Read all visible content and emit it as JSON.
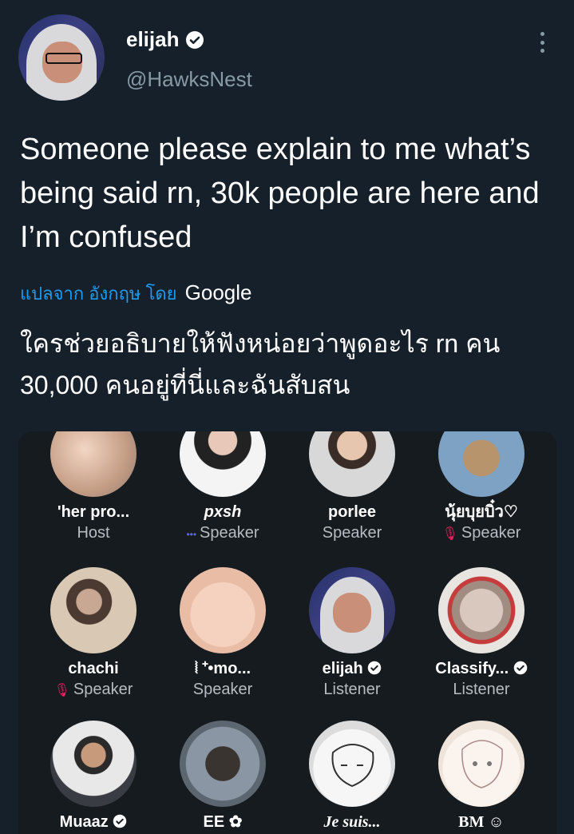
{
  "author": {
    "name": "elijah",
    "handle": "@HawksNest"
  },
  "tweet": {
    "text": "Someone please explain to me what’s being said rn, 30k people are here and I’m confused"
  },
  "translation": {
    "label": "แปลจาก อังกฤษ โดย",
    "provider": "Google",
    "text": "ใครช่วยอธิบายให้ฟังหน่อยว่าพูดอะไร rn คน 30,000 คนอยู่ที่นี่และฉันสับสน"
  },
  "space": {
    "participants": [
      {
        "name": "'her pro...",
        "role": "Host"
      },
      {
        "name": "pxsh",
        "role": "Speaker"
      },
      {
        "name": "porlee",
        "role": "Speaker"
      },
      {
        "name": "นุ้ยบุยบิ๋ว♡",
        "role": "Speaker"
      },
      {
        "name": "chachi",
        "role": "Speaker"
      },
      {
        "name": "⦚ ⁺•mo...",
        "role": "Speaker"
      },
      {
        "name": "elijah",
        "role": "Listener"
      },
      {
        "name": "Classify...",
        "role": "Listener"
      },
      {
        "name": "Muaaz",
        "role": ""
      },
      {
        "name": "ΕΕ ✿",
        "role": ""
      },
      {
        "name": "Je suis...",
        "role": ""
      },
      {
        "name": "BM ☺",
        "role": ""
      }
    ]
  },
  "colors": {
    "background": "#15202b",
    "accent": "#1d9bf0",
    "muted": "#8899a6"
  }
}
